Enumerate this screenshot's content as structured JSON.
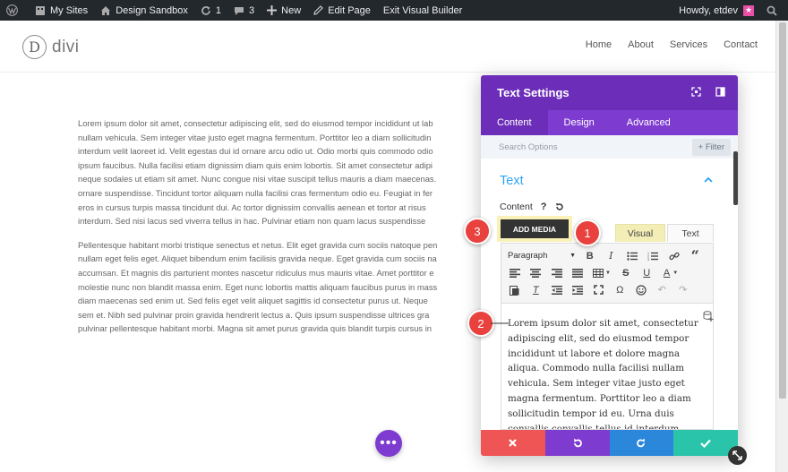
{
  "adminbar": {
    "my_sites": "My Sites",
    "site_name": "Design Sandbox",
    "updates_count": "1",
    "comments_count": "3",
    "new_label": "New",
    "edit_page": "Edit Page",
    "exit_builder": "Exit Visual Builder",
    "howdy": "Howdy, etdev"
  },
  "header": {
    "logo_letter": "D",
    "logo_text": "divi",
    "nav": [
      "Home",
      "About",
      "Services",
      "Contact"
    ]
  },
  "content": {
    "paragraph1": [
      "Lorem ipsum dolor sit amet, consectetur adipiscing elit, sed do eiusmod tempor incididunt ut lab",
      "nullam vehicula. Sem integer vitae justo eget magna fermentum. Porttitor leo a diam sollicitudin",
      "interdum velit laoreet id. Velit egestas dui id ornare arcu odio ut. Odio morbi quis commodo odio",
      "ipsum faucibus. Nulla facilisi etiam dignissim diam quis enim lobortis. Sit amet consectetur adipi",
      "neque sodales ut etiam sit amet. Nunc congue nisi vitae suscipit tellus mauris a diam maecenas.",
      "ornare suspendisse. Tincidunt tortor aliquam nulla facilisi cras fermentum odio eu. Feugiat in fer",
      "eros in cursus turpis massa tincidunt dui. Ac tortor dignissim convallis aenean et tortor at risus",
      "interdum. Sed nisi lacus sed viverra tellus in hac. Pulvinar etiam non quam lacus suspendisse"
    ],
    "paragraph2": [
      "Pellentesque habitant morbi tristique senectus et netus. Elit eget gravida cum sociis natoque pen",
      "nullam eget felis eget. Aliquet bibendum enim facilisis gravida neque. Eget gravida cum sociis na",
      "accumsan. Et magnis dis parturient montes nascetur ridiculus mus mauris vitae. Amet porttitor e",
      "molestie nunc non blandit massa enim. Eget nunc lobortis mattis aliquam faucibus purus in mass",
      "diam maecenas sed enim ut. Sed felis eget velit aliquet sagittis id consectetur purus ut. Neque",
      "sem et. Nibh sed pulvinar proin gravida hendrerit lectus a. Quis ipsum suspendisse ultrices gra",
      "pulvinar pellentesque habitant morbi. Magna sit amet purus gravida quis blandit turpis cursus in"
    ]
  },
  "modal": {
    "title": "Text Settings",
    "tabs": [
      "Content",
      "Design",
      "Advanced"
    ],
    "search_placeholder": "Search Options",
    "filter_label": "+ Filter",
    "section_title": "Text",
    "content_label": "Content",
    "help_mark": "?",
    "add_media": "ADD MEDIA",
    "tab_visual": "Visual",
    "tab_text": "Text",
    "format_select": "Paragraph",
    "editor_lines": [
      "Lorem ipsum dolor sit amet, consectetur",
      "adipiscing elit, sed do eiusmod tempor",
      "incididunt ut labore et dolore magna",
      "aliqua. Commodo nulla facilisi nullam",
      "vehicula. Sem integer vitae justo eget",
      "magna fermentum. Porttitor leo a diam",
      "sollicitudin tempor id eu. Urna duis",
      "convallis convallis tellus id interdum"
    ]
  },
  "callouts": {
    "one": "1",
    "two": "2",
    "three": "3"
  },
  "colors": {
    "purple_dark": "#6c2eb9",
    "purple": "#7e3bd0",
    "blue_link": "#2ea3f2",
    "cancel": "#ef5555",
    "undo": "#7e3bd0",
    "redo": "#2b87da",
    "save": "#29c4a9",
    "callout": "#e8413e"
  },
  "icons": [
    "wordpress-icon",
    "home-icon",
    "refresh-icon",
    "comment-icon",
    "plus-icon",
    "pencil-icon",
    "search-icon"
  ]
}
